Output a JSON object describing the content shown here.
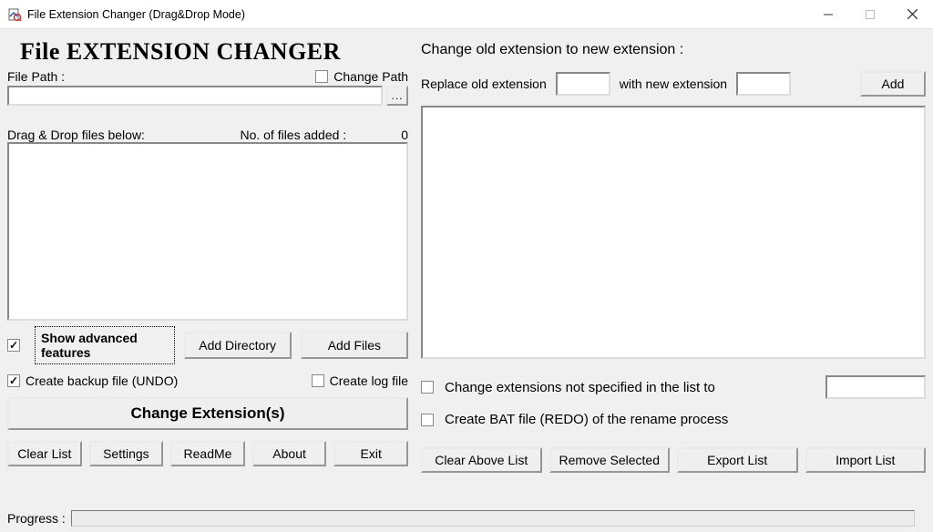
{
  "window": {
    "title": "File Extension Changer (Drag&Drop Mode)"
  },
  "left": {
    "heading": "File EXTENSION CHANGER",
    "file_path_label": "File Path :",
    "change_path_label": "Change Path",
    "browse_btn": "...",
    "drag_drop_label": "Drag & Drop files below:",
    "count_label": "No. of files added :",
    "count_value": "0",
    "show_advanced_label": "Show advanced features",
    "add_directory": "Add Directory",
    "add_files": "Add Files",
    "create_backup_label": "Create backup file (UNDO)",
    "create_log_label": "Create log file",
    "change_ext_btn": "Change Extension(s)",
    "buttons": {
      "clear_list": "Clear List",
      "settings": "Settings",
      "readme": "ReadMe",
      "about": "About",
      "exit": "Exit"
    }
  },
  "right": {
    "heading": "Change old extension to new extension :",
    "replace_label": "Replace old extension",
    "with_label": "with new extension",
    "add_btn": "Add",
    "change_not_specified_label": "Change extensions not specified in the list to",
    "create_bat_label": "Create BAT file (REDO) of the rename process",
    "buttons": {
      "clear_above": "Clear Above List",
      "remove_selected": "Remove Selected",
      "export_list": "Export List",
      "import_list": "Import List"
    }
  },
  "progress_label": "Progress :"
}
